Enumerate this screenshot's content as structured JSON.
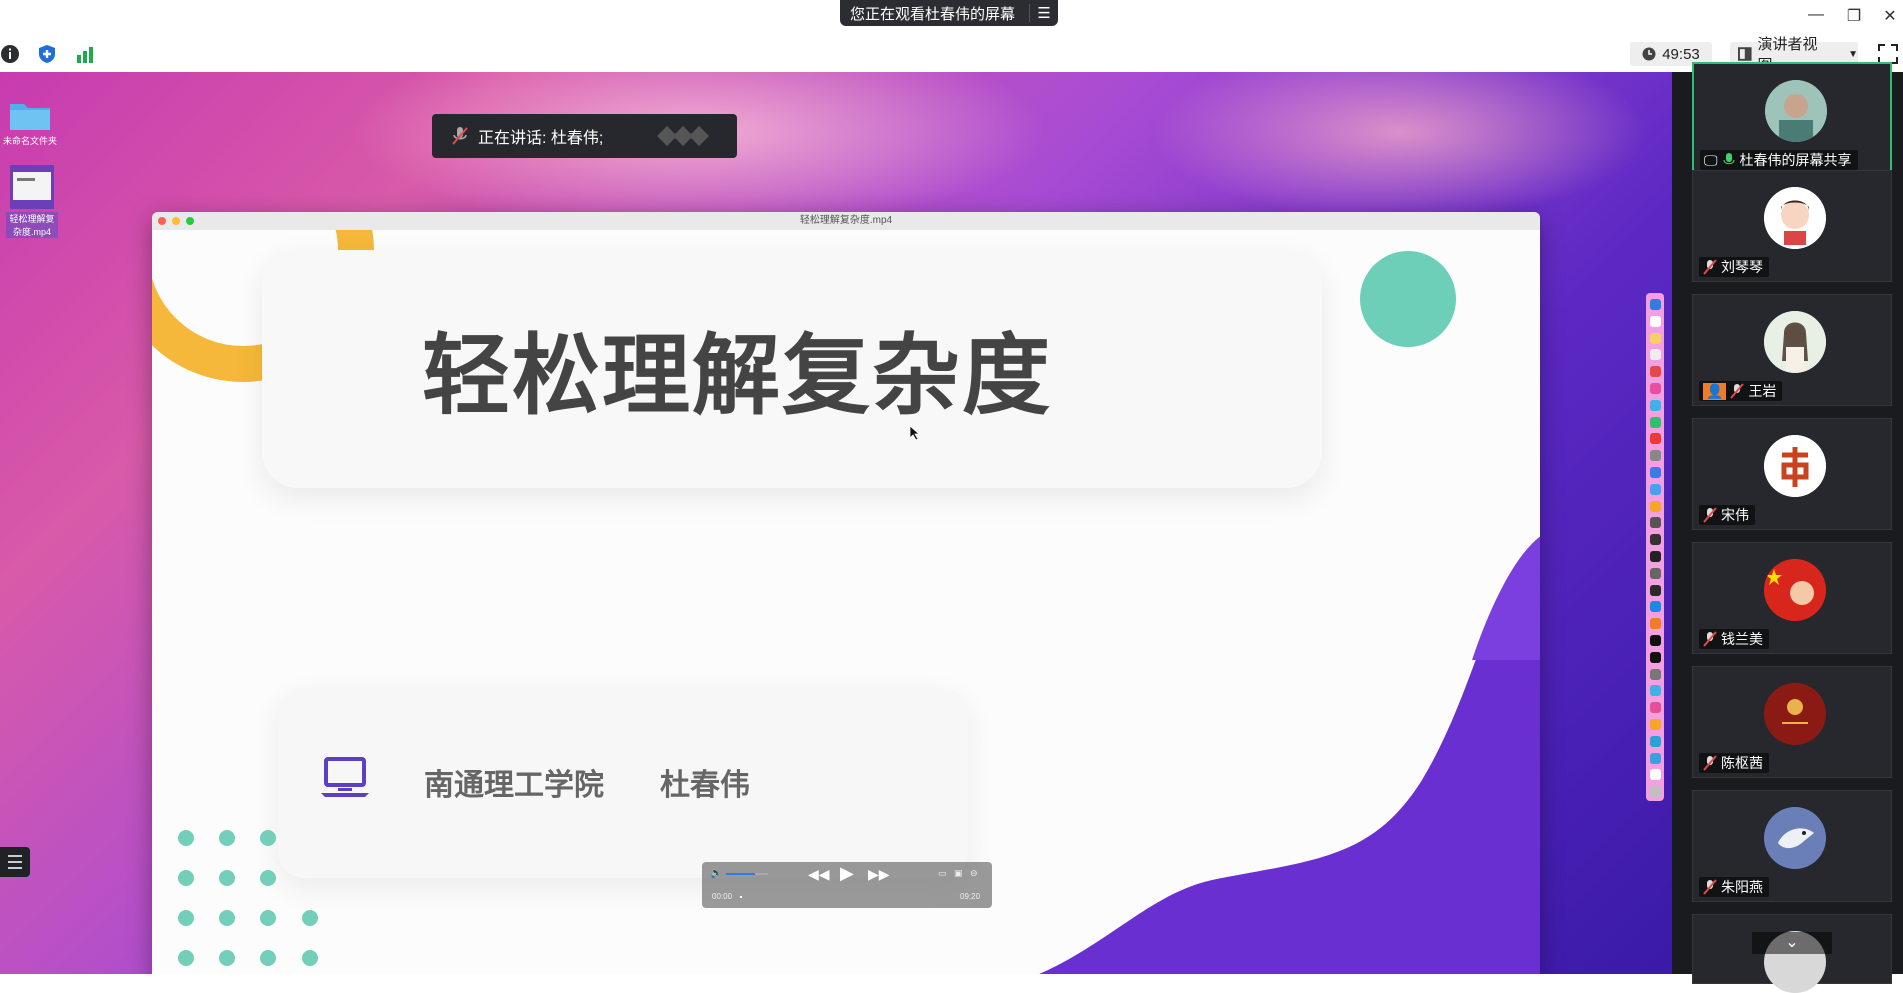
{
  "top": {
    "share_banner": "您正在观看杜春伟的屏幕"
  },
  "toolbar": {
    "timer": "49:53",
    "view_label": "演讲者视图"
  },
  "speaking": {
    "label": "正在讲话: 杜春伟;"
  },
  "desktop": {
    "folder_label": "未命名文件夹",
    "file_label": "轻松理解复杂度.mp4"
  },
  "video_window": {
    "title": "轻松理解复杂度.mp4",
    "slide_title": "轻松理解复杂度",
    "school": "南通理工学院",
    "author": "杜春伟",
    "player": {
      "current": "00:00",
      "total": "09:20",
      "volume": 0.7,
      "progress": 0.0
    }
  },
  "participants": [
    {
      "name": "杜春伟的屏幕共享",
      "mic": "on",
      "sharing": true
    },
    {
      "name": "刘琴琴",
      "mic": "muted"
    },
    {
      "name": "王岩",
      "mic": "muted",
      "host": true
    },
    {
      "name": "宋伟",
      "mic": "muted"
    },
    {
      "name": "钱兰美",
      "mic": "muted"
    },
    {
      "name": "陈枢茜",
      "mic": "muted"
    },
    {
      "name": "朱阳燕",
      "mic": "muted"
    }
  ],
  "colors": {
    "teal": "#6ecfb9",
    "yellow": "#f5b83a",
    "purple": "#6a2fd0",
    "sidebar_bg": "#1a1b1e",
    "active_border": "#2fbf71"
  }
}
